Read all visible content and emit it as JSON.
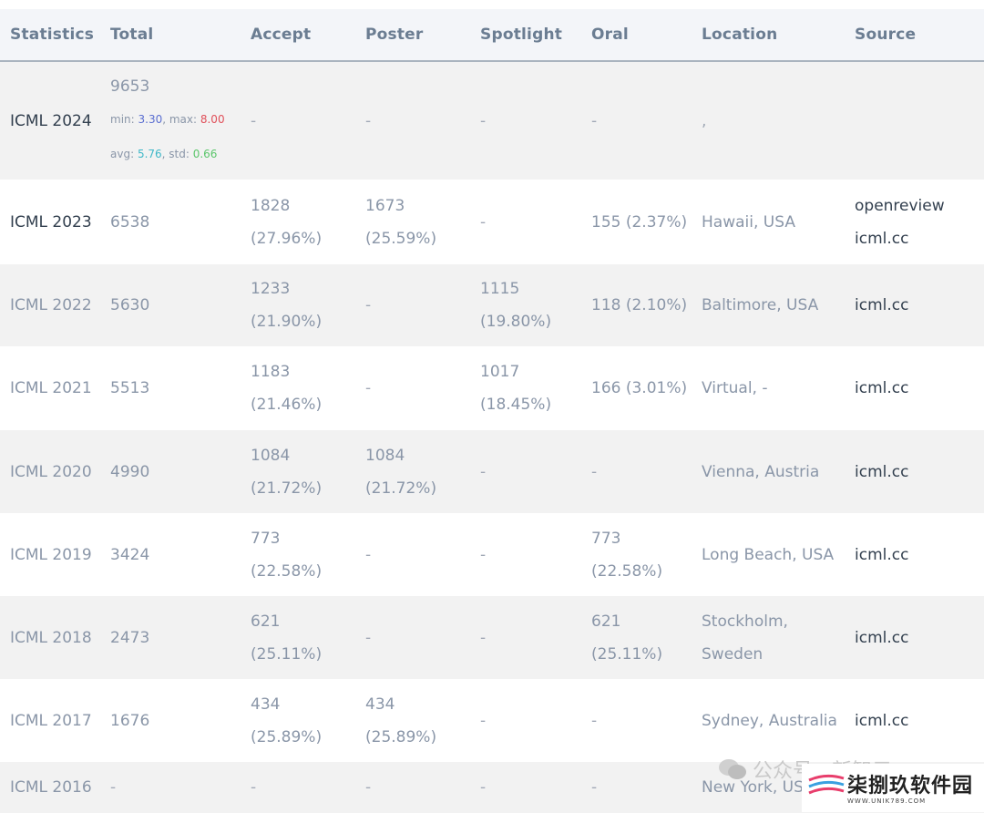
{
  "table": {
    "headers": [
      "Statistics",
      "Total",
      "Accept",
      "Poster",
      "Spotlight",
      "Oral",
      "Location",
      "Source"
    ],
    "rows": [
      {
        "conf": "ICML 2024",
        "total": "9653",
        "min": "3.30",
        "max": "8.00",
        "avg": "5.76",
        "std": "0.66",
        "accept": "-",
        "poster": "-",
        "spotlight": "-",
        "oral": "-",
        "location": ",",
        "source": ""
      },
      {
        "conf": "ICML 2023",
        "total": "6538",
        "accept": "1828 (27.96%)",
        "poster": "1673 (25.59%)",
        "spotlight": "-",
        "oral": "155 (2.37%)",
        "location": "Hawaii, USA",
        "source": "openreview icml.cc"
      },
      {
        "conf": "ICML 2022",
        "total": "5630",
        "accept": "1233 (21.90%)",
        "poster": "-",
        "spotlight": "1115 (19.80%)",
        "oral": "118 (2.10%)",
        "location": "Baltimore, USA",
        "source": "icml.cc"
      },
      {
        "conf": "ICML 2021",
        "total": "5513",
        "accept": "1183 (21.46%)",
        "poster": "-",
        "spotlight": "1017 (18.45%)",
        "oral": "166 (3.01%)",
        "location": "Virtual, -",
        "source": "icml.cc"
      },
      {
        "conf": "ICML 2020",
        "total": "4990",
        "accept": "1084 (21.72%)",
        "poster": "1084 (21.72%)",
        "spotlight": "-",
        "oral": "-",
        "location": "Vienna, Austria",
        "source": "icml.cc"
      },
      {
        "conf": "ICML 2019",
        "total": "3424",
        "accept": "773 (22.58%)",
        "poster": "-",
        "spotlight": "-",
        "oral": "773 (22.58%)",
        "location": "Long Beach, USA",
        "source": "icml.cc"
      },
      {
        "conf": "ICML 2018",
        "total": "2473",
        "accept": "621 (25.11%)",
        "poster": "-",
        "spotlight": "-",
        "oral": "621 (25.11%)",
        "location": "Stockholm, Sweden",
        "source": "icml.cc"
      },
      {
        "conf": "ICML 2017",
        "total": "1676",
        "accept": "434 (25.89%)",
        "poster": "434 (25.89%)",
        "spotlight": "-",
        "oral": "-",
        "location": "Sydney, Australia",
        "source": "icml.cc"
      },
      {
        "conf": "ICML 2016",
        "total": "-",
        "accept": "-",
        "poster": "-",
        "spotlight": "-",
        "oral": "-",
        "location": "New York, US",
        "source": ""
      }
    ],
    "stat_labels": {
      "min": "min: ",
      "max": ", max: ",
      "avg": "avg: ",
      "std": ", std: "
    }
  },
  "watermark": {
    "text": "公众号 · 新智元"
  },
  "logo": {
    "text": "柒捌玖软件园",
    "url": "WWW.UNIK789.COM"
  },
  "colors": {
    "header_bg": "#f3f5f9",
    "stripe": "#f2f2f2",
    "min": "#5b6fd1",
    "max": "#e0505a",
    "avg": "#3fb8c8",
    "std": "#5cc66c"
  }
}
